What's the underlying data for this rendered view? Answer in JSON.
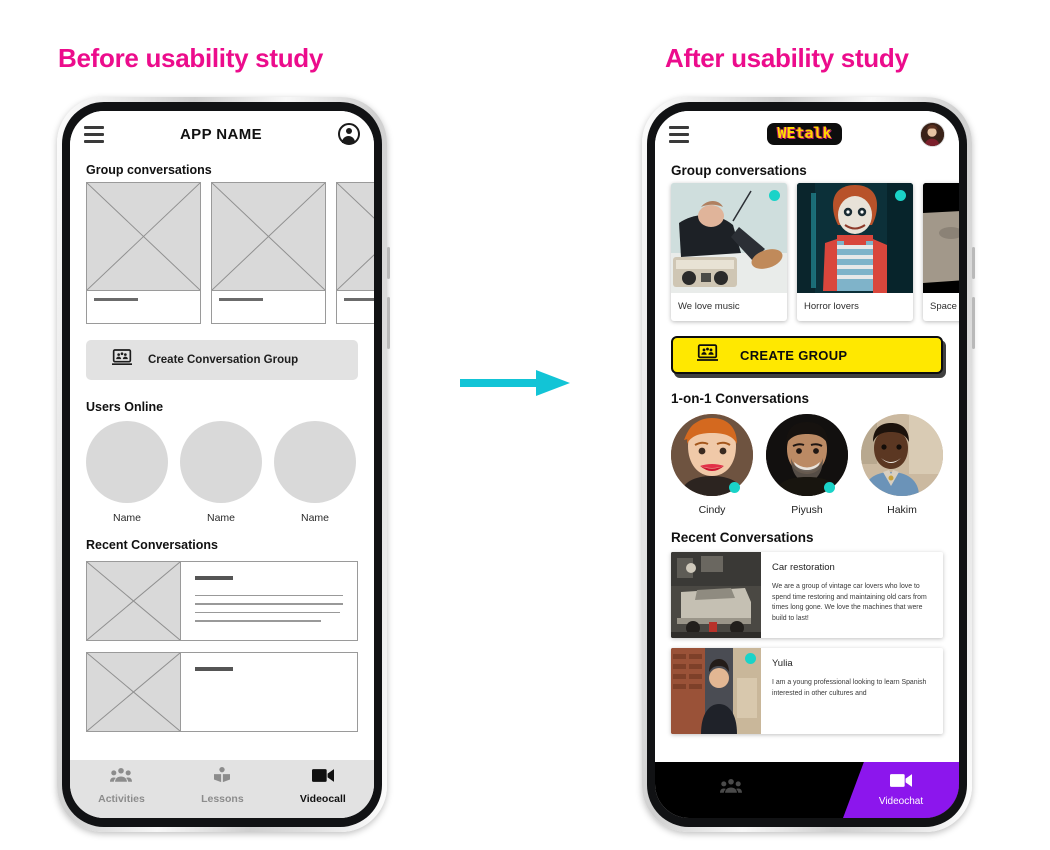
{
  "headings": {
    "before": "Before usability study",
    "after": "After usability study"
  },
  "arrow": {
    "name": "transition-arrow",
    "color": "#12c4d6"
  },
  "colors": {
    "heading_pink": "#ec0c8c",
    "arrow_cyan": "#12c4d6",
    "accent_yellow": "#ffe800",
    "online_teal": "#1ad3c8",
    "active_purple": "#8c16ed",
    "wireframe_gray": "#d9d9d9"
  },
  "before_phone": {
    "topbar": {
      "menu_icon": "hamburger-icon",
      "title": "APP NAME",
      "account_icon": "account-circle-icon"
    },
    "group_section": {
      "heading": "Group conversations",
      "cards": [
        {
          "placeholder": "image-placeholder"
        },
        {
          "placeholder": "image-placeholder"
        },
        {
          "placeholder": "image-placeholder"
        }
      ]
    },
    "create_button": {
      "icon": "group-presentation-icon",
      "label": "Create  Conversation Group"
    },
    "users_section": {
      "heading": "Users Online",
      "users": [
        {
          "name": "Name"
        },
        {
          "name": "Name"
        },
        {
          "name": "Name"
        }
      ]
    },
    "recent_section": {
      "heading": "Recent Conversations",
      "items": [
        {
          "placeholder": "image-placeholder"
        },
        {
          "placeholder": "image-placeholder"
        }
      ]
    },
    "nav": [
      {
        "icon": "people-icon",
        "label": "Activities",
        "active": false
      },
      {
        "icon": "book-icon",
        "label": "Lessons",
        "active": false
      },
      {
        "icon": "videocam-icon",
        "label": "Videocall",
        "active": true
      }
    ]
  },
  "after_phone": {
    "topbar": {
      "menu_icon": "hamburger-icon",
      "logo_we": "WE",
      "logo_talk": "talk",
      "logo_full": "WEtalk",
      "avatar": "user-avatar-photo"
    },
    "group_section": {
      "heading": "Group conversations",
      "cards": [
        {
          "caption": "We love music",
          "online": true,
          "image": "boombox-person-photo"
        },
        {
          "caption": "Horror lovers",
          "online": true,
          "image": "horror-doll-photo"
        },
        {
          "caption": "Space",
          "online": false,
          "image": "moon-surface-photo"
        }
      ]
    },
    "create_button": {
      "icon": "group-presentation-icon",
      "label": "CREATE GROUP"
    },
    "people_section": {
      "heading": "1-on-1 Conversations",
      "people": [
        {
          "name": "Cindy",
          "online": true
        },
        {
          "name": "Piyush",
          "online": true
        },
        {
          "name": "Hakim",
          "online": false
        }
      ]
    },
    "recent_section": {
      "heading": "Recent Conversations",
      "items": [
        {
          "title": "Car restoration",
          "description": "We are a group of vintage car lovers who love to spend time restoring and maintaining old cars from times long gone. We love the machines that were build to last!",
          "online": false,
          "image": "vintage-car-garage-photo"
        },
        {
          "title": "Yulia",
          "description": "I am a young professional looking to learn Spanish interested in other cultures and",
          "online": true,
          "image": "yulia-portrait-photo"
        }
      ]
    },
    "nav": [
      {
        "icon": "people-icon",
        "label": "",
        "active": false
      },
      {
        "icon": "book-icon",
        "label": "",
        "active": false
      },
      {
        "icon": "videocam-icon",
        "label": "Videochat",
        "active": true
      }
    ]
  }
}
